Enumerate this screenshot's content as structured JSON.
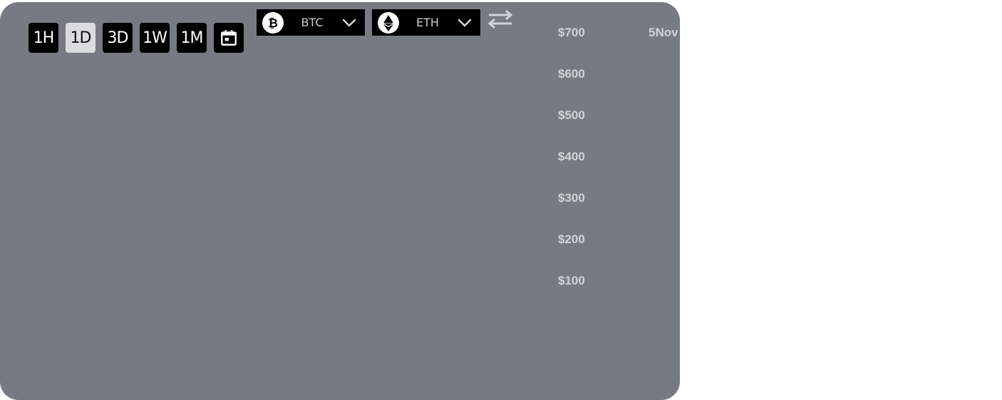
{
  "timeframes": [
    {
      "label": "1H",
      "active": false
    },
    {
      "label": "1D",
      "active": true
    },
    {
      "label": "3D",
      "active": false
    },
    {
      "label": "1W",
      "active": false
    },
    {
      "label": "1M",
      "active": false
    }
  ],
  "calendar_icon": "calendar-icon",
  "pair": {
    "base": {
      "label": "BTC",
      "icon": "bitcoin-icon"
    },
    "quote": {
      "label": "ETH",
      "icon": "ethereum-icon"
    },
    "swap_icon": "swap-arrows-icon"
  },
  "chart": {
    "y_axis_labels": [
      "$700",
      "$600",
      "$500",
      "$400",
      "$300",
      "$200",
      "$100"
    ],
    "x_axis_labels": [
      "5Nov"
    ]
  },
  "colors": {
    "panel_bg": "#787a83",
    "button_bg": "#000000",
    "active_button_bg": "#dcdce0",
    "axis_text": "#d2d3d8"
  }
}
